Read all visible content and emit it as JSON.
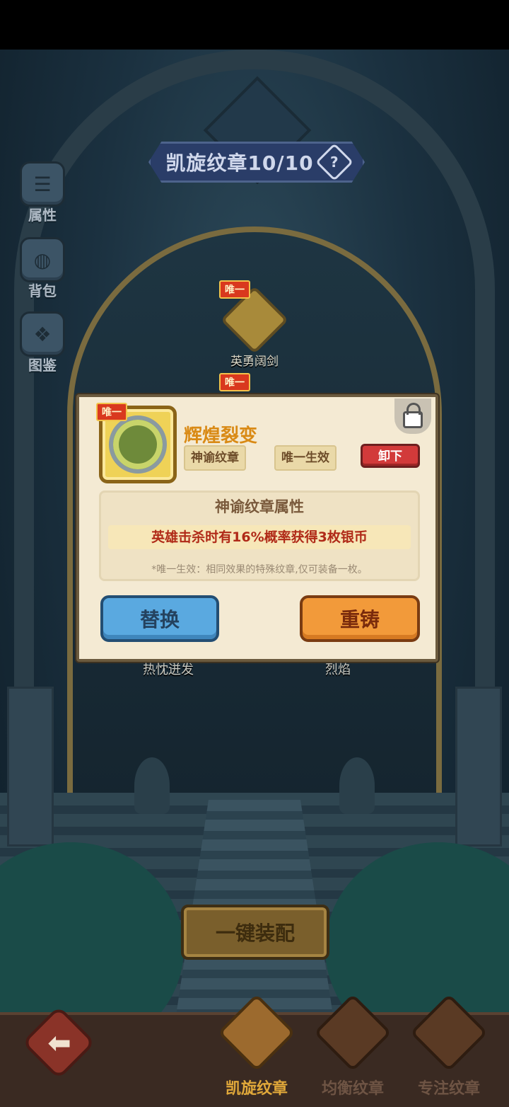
{
  "header": {
    "title": "凯旋纹章10/10",
    "help_glyph": "?"
  },
  "sidebar": {
    "items": [
      {
        "label": "属性",
        "icon": "list-icon"
      },
      {
        "label": "背包",
        "icon": "bag-icon"
      },
      {
        "label": "图鉴",
        "icon": "book-icon"
      }
    ]
  },
  "slots": {
    "top": {
      "name": "英勇阔剑",
      "tag": "唯一"
    },
    "middle_tag": "唯一",
    "left_label": "热忱迸发",
    "right_label": "烈焰"
  },
  "dialog": {
    "unique_tag": "唯一",
    "item_name": "辉煌裂变",
    "chip_type": "神谕纹章",
    "chip_effect": "唯一生效",
    "unequip_label": "卸下",
    "attr_title": "神谕纹章属性",
    "attr_effect": "英雄击杀时有16%概率获得3枚银币",
    "attr_note": "*唯一生效：相同效果的特殊纹章,仅可装备一枚。",
    "replace_label": "替换",
    "reforge_label": "重铸"
  },
  "equip_all_label": "一键装配",
  "bottom_tabs": [
    {
      "label": "凯旋纹章",
      "active": true
    },
    {
      "label": "均衡纹章",
      "active": false
    },
    {
      "label": "专注纹章",
      "active": false
    }
  ],
  "back_glyph": "⬅",
  "colors": {
    "accent_gold": "#d98a15",
    "effect_red": "#b02a18",
    "button_blue": "#5aa9e0",
    "button_orange": "#f29a3a",
    "unequip_red": "#d23a3a"
  }
}
